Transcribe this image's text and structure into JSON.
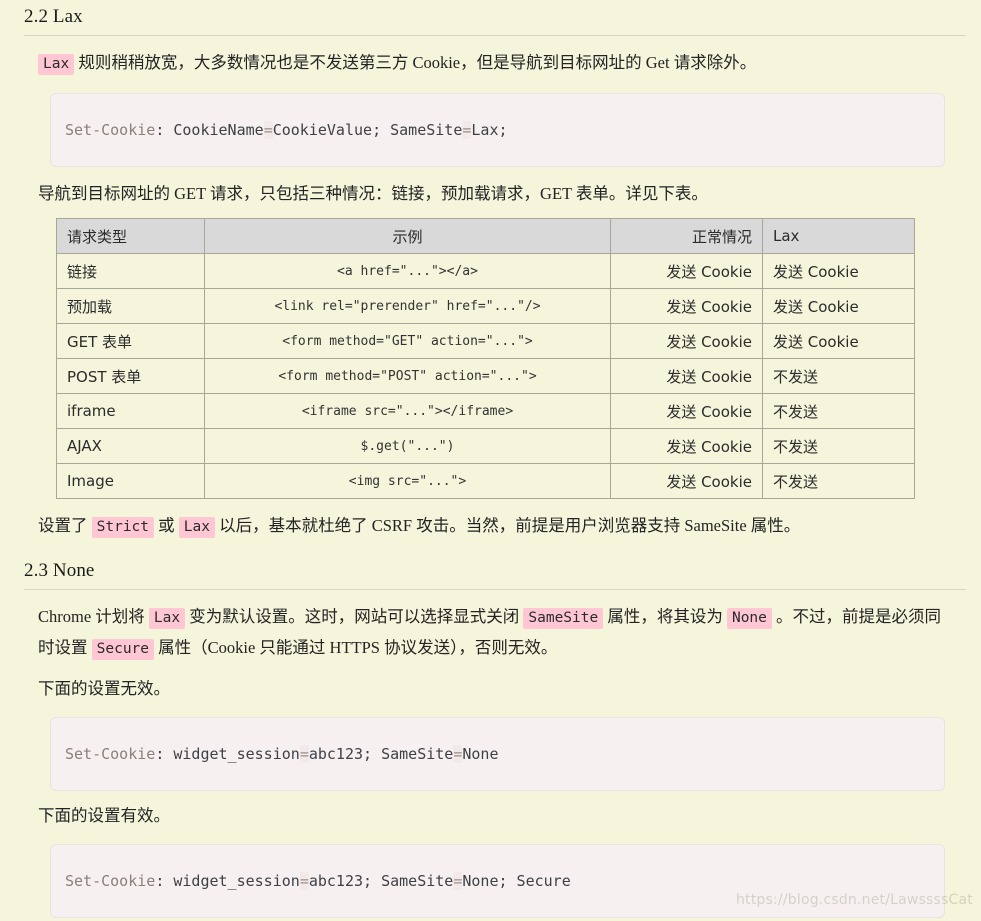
{
  "sections": {
    "lax": {
      "heading": "2.2 Lax",
      "intro_chip": "Lax",
      "intro_text_a": " 规则稍稍放宽，大多数情况也是不发送第三方 Cookie，但是导航到目标网址的 Get 请求除外。",
      "code": {
        "full": "Set-Cookie: CookieName=CookieValue; SameSite=Lax;",
        "p1": "Set-Cookie",
        "p2": ": CookieName",
        "p3": "=",
        "p4": "CookieValue",
        "p5": "; SameSite",
        "p6": "=",
        "p7": "Lax;"
      },
      "table_intro": "导航到目标网址的 GET 请求，只包括三种情况：链接，预加载请求，GET 表单。详见下表。",
      "closing": {
        "pre": "设置了 ",
        "chip1": "Strict",
        "mid": " 或 ",
        "chip2": "Lax",
        "post": " 以后，基本就杜绝了 CSRF 攻击。当然，前提是用户浏览器支持 SameSite 属性。"
      }
    },
    "none": {
      "heading": "2.3 None",
      "para1": {
        "pre": "Chrome 计划将 ",
        "chip1": "Lax",
        "mid1": " 变为默认设置。这时，网站可以选择显式关闭 ",
        "chip2": "SameSite",
        "mid2": " 属性，将其设为 ",
        "chip3": "None",
        "mid3": " 。不过，前提是必须同时设置 ",
        "chip4": "Secure",
        "post": " 属性（Cookie 只能通过 HTTPS 协议发送），否则无效。"
      },
      "invalid_label": "下面的设置无效。",
      "invalid_code": {
        "full": "Set-Cookie: widget_session=abc123; SameSite=None",
        "p1": "Set-Cookie",
        "p2": ": widget_session",
        "p3": "=",
        "p4": "abc123",
        "p5": "; SameSite",
        "p6": "=",
        "p7": "None"
      },
      "valid_label": "下面的设置有效。",
      "valid_code": {
        "full": "Set-Cookie: widget_session=abc123; SameSite=None; Secure",
        "p1": "Set-Cookie",
        "p2": ": widget_session",
        "p3": "=",
        "p4": "abc123",
        "p5": "; SameSite",
        "p6": "=",
        "p7": "None; Secure"
      }
    }
  },
  "table": {
    "headers": [
      "请求类型",
      "示例",
      "正常情况",
      "Lax"
    ],
    "rows": [
      {
        "type": "链接",
        "example": "<a href=\"...\"></a>",
        "normal": "发送 Cookie",
        "lax": "发送 Cookie"
      },
      {
        "type": "预加载",
        "example": "<link rel=\"prerender\" href=\"...\"/>",
        "normal": "发送 Cookie",
        "lax": "发送 Cookie"
      },
      {
        "type": "GET 表单",
        "example": "<form method=\"GET\" action=\"...\">",
        "normal": "发送 Cookie",
        "lax": "发送 Cookie"
      },
      {
        "type": "POST 表单",
        "example": "<form method=\"POST\" action=\"...\">",
        "normal": "发送 Cookie",
        "lax": "不发送"
      },
      {
        "type": "iframe",
        "example": "<iframe src=\"...\"></iframe>",
        "normal": "发送 Cookie",
        "lax": "不发送"
      },
      {
        "type": "AJAX",
        "example": "$.get(\"...\")",
        "normal": "发送 Cookie",
        "lax": "不发送"
      },
      {
        "type": "Image",
        "example": "<img src=\"...\">",
        "normal": "发送 Cookie",
        "lax": "不发送"
      }
    ]
  },
  "watermark": "https://blog.csdn.net/LawssssCat",
  "colors": {
    "page_background": "#f5f5dc",
    "code_background": "#f6f1f0",
    "chip_highlight": "#ffc7d4",
    "table_header_background": "#d9d9d9",
    "table_border": "#a8a89a",
    "rule": "#d6d6c4"
  }
}
